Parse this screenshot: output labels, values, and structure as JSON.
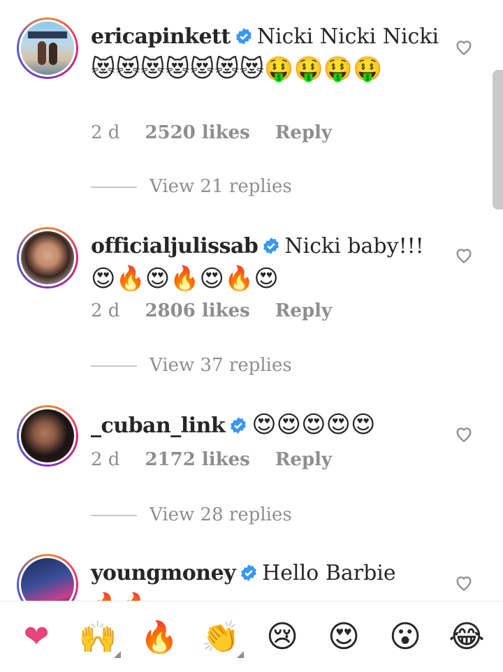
{
  "comments": [
    {
      "username": "ericapinkett",
      "text": "Nicki Nicki Nicki",
      "emoji_line": "😻😻😻😻😻😻😻🤑🤑🤑🤑",
      "time": "2 d",
      "likes": "2520 likes",
      "reply": "Reply",
      "view_replies": "View 21 replies"
    },
    {
      "username": "officialjulissab",
      "text": "Nicki baby!!!",
      "emoji_line": "😍🔥😍🔥😍🔥😍",
      "time": "2 d",
      "likes": "2806 likes",
      "reply": "Reply",
      "view_replies": "View 37 replies"
    },
    {
      "username": "_cuban_link",
      "text": "",
      "emoji_line": "😍😍😍😍😍",
      "time": "2 d",
      "likes": "2172 likes",
      "reply": "Reply",
      "view_replies": "View 28 replies"
    },
    {
      "username": "youngmoney",
      "text": "Hello Barbie",
      "emoji_line": "🔥🔥",
      "time": "",
      "likes": "",
      "reply": "",
      "view_replies": ""
    }
  ],
  "reaction_bar": {
    "items": [
      "❤",
      "🙌",
      "🔥",
      "👏",
      "😢",
      "😍",
      "😮",
      "😂"
    ]
  },
  "colors": {
    "verified": "#3897f0",
    "reaction_heart": "#e6457e"
  },
  "icons": [
    "verified-badge-icon",
    "heart-outline-icon",
    "skin-tone-indicator"
  ]
}
